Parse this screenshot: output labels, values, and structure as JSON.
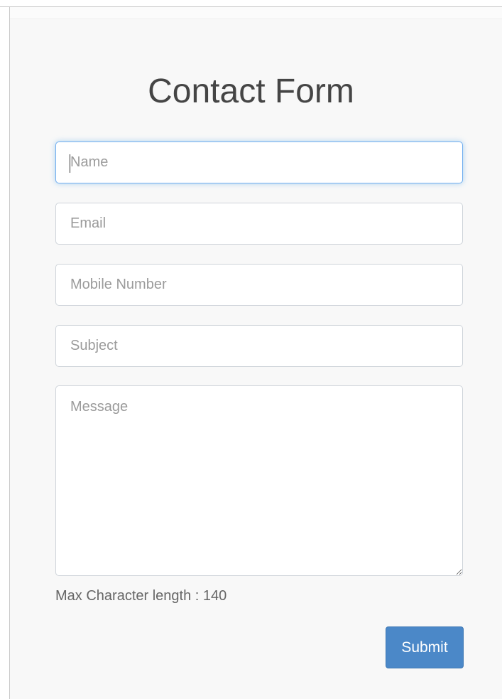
{
  "form": {
    "title": "Contact Form",
    "fields": {
      "name": {
        "value": "",
        "placeholder": "Name",
        "focused": true
      },
      "email": {
        "value": "",
        "placeholder": "Email"
      },
      "mobile": {
        "value": "",
        "placeholder": "Mobile Number"
      },
      "subject": {
        "value": "",
        "placeholder": "Subject"
      },
      "message": {
        "value": "",
        "placeholder": "Message"
      }
    },
    "hint": "Max Character length : 140",
    "submit_label": "Submit"
  },
  "colors": {
    "panel_background": "#f8f8f8",
    "focus_border": "#72aef0",
    "button_background": "#4b88c8",
    "button_text": "#ffffff",
    "title_text": "#454545",
    "placeholder_text": "#9b9b9b"
  }
}
